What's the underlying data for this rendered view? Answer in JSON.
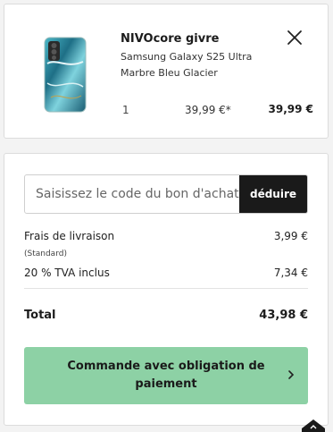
{
  "product": {
    "name": "NIVOcore givre",
    "model": "Samsung Galaxy S25 Ultra",
    "variant": "Marbre Bleu Glacier",
    "quantity": "1",
    "unit_price": "39,99 €*",
    "line_total": "39,99 €",
    "image_icon": "phone-case-image",
    "remove_icon": "close-icon"
  },
  "voucher": {
    "placeholder": "Saisissez le code du bon d'achat",
    "button_label": "déduire"
  },
  "summary": {
    "shipping_label": "Frais de livraison",
    "shipping_value": "3,99 €",
    "shipping_method": "(Standard)",
    "vat_label": "20 % TVA inclus",
    "vat_value": "7,34 €",
    "total_label": "Total",
    "total_value": "43,98 €"
  },
  "cta": {
    "label": "Commande avec obligation de paiement",
    "icon": "chevron-right-icon",
    "color": "#8dd1a5"
  }
}
